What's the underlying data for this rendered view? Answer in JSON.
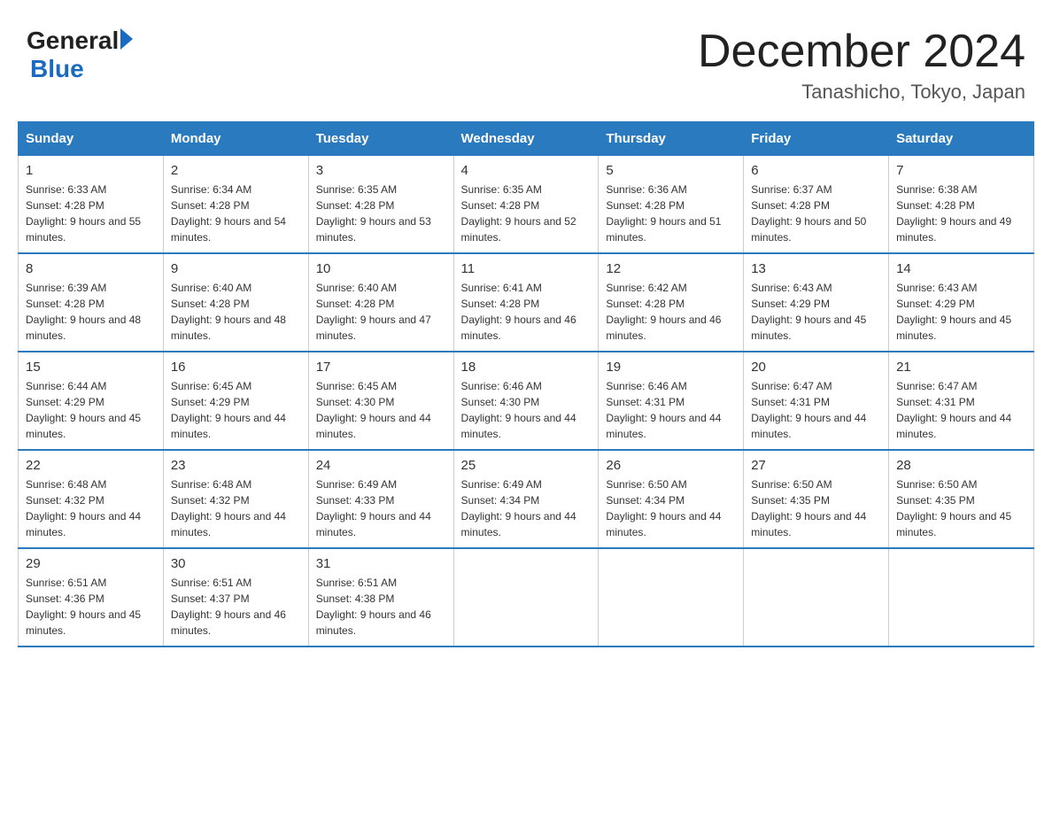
{
  "header": {
    "logo_general": "General",
    "logo_blue": "Blue",
    "month_title": "December 2024",
    "location": "Tanashicho, Tokyo, Japan"
  },
  "days_of_week": [
    "Sunday",
    "Monday",
    "Tuesday",
    "Wednesday",
    "Thursday",
    "Friday",
    "Saturday"
  ],
  "weeks": [
    [
      {
        "day": "1",
        "sunrise": "6:33 AM",
        "sunset": "4:28 PM",
        "daylight": "9 hours and 55 minutes."
      },
      {
        "day": "2",
        "sunrise": "6:34 AM",
        "sunset": "4:28 PM",
        "daylight": "9 hours and 54 minutes."
      },
      {
        "day": "3",
        "sunrise": "6:35 AM",
        "sunset": "4:28 PM",
        "daylight": "9 hours and 53 minutes."
      },
      {
        "day": "4",
        "sunrise": "6:35 AM",
        "sunset": "4:28 PM",
        "daylight": "9 hours and 52 minutes."
      },
      {
        "day": "5",
        "sunrise": "6:36 AM",
        "sunset": "4:28 PM",
        "daylight": "9 hours and 51 minutes."
      },
      {
        "day": "6",
        "sunrise": "6:37 AM",
        "sunset": "4:28 PM",
        "daylight": "9 hours and 50 minutes."
      },
      {
        "day": "7",
        "sunrise": "6:38 AM",
        "sunset": "4:28 PM",
        "daylight": "9 hours and 49 minutes."
      }
    ],
    [
      {
        "day": "8",
        "sunrise": "6:39 AM",
        "sunset": "4:28 PM",
        "daylight": "9 hours and 48 minutes."
      },
      {
        "day": "9",
        "sunrise": "6:40 AM",
        "sunset": "4:28 PM",
        "daylight": "9 hours and 48 minutes."
      },
      {
        "day": "10",
        "sunrise": "6:40 AM",
        "sunset": "4:28 PM",
        "daylight": "9 hours and 47 minutes."
      },
      {
        "day": "11",
        "sunrise": "6:41 AM",
        "sunset": "4:28 PM",
        "daylight": "9 hours and 46 minutes."
      },
      {
        "day": "12",
        "sunrise": "6:42 AM",
        "sunset": "4:28 PM",
        "daylight": "9 hours and 46 minutes."
      },
      {
        "day": "13",
        "sunrise": "6:43 AM",
        "sunset": "4:29 PM",
        "daylight": "9 hours and 45 minutes."
      },
      {
        "day": "14",
        "sunrise": "6:43 AM",
        "sunset": "4:29 PM",
        "daylight": "9 hours and 45 minutes."
      }
    ],
    [
      {
        "day": "15",
        "sunrise": "6:44 AM",
        "sunset": "4:29 PM",
        "daylight": "9 hours and 45 minutes."
      },
      {
        "day": "16",
        "sunrise": "6:45 AM",
        "sunset": "4:29 PM",
        "daylight": "9 hours and 44 minutes."
      },
      {
        "day": "17",
        "sunrise": "6:45 AM",
        "sunset": "4:30 PM",
        "daylight": "9 hours and 44 minutes."
      },
      {
        "day": "18",
        "sunrise": "6:46 AM",
        "sunset": "4:30 PM",
        "daylight": "9 hours and 44 minutes."
      },
      {
        "day": "19",
        "sunrise": "6:46 AM",
        "sunset": "4:31 PM",
        "daylight": "9 hours and 44 minutes."
      },
      {
        "day": "20",
        "sunrise": "6:47 AM",
        "sunset": "4:31 PM",
        "daylight": "9 hours and 44 minutes."
      },
      {
        "day": "21",
        "sunrise": "6:47 AM",
        "sunset": "4:31 PM",
        "daylight": "9 hours and 44 minutes."
      }
    ],
    [
      {
        "day": "22",
        "sunrise": "6:48 AM",
        "sunset": "4:32 PM",
        "daylight": "9 hours and 44 minutes."
      },
      {
        "day": "23",
        "sunrise": "6:48 AM",
        "sunset": "4:32 PM",
        "daylight": "9 hours and 44 minutes."
      },
      {
        "day": "24",
        "sunrise": "6:49 AM",
        "sunset": "4:33 PM",
        "daylight": "9 hours and 44 minutes."
      },
      {
        "day": "25",
        "sunrise": "6:49 AM",
        "sunset": "4:34 PM",
        "daylight": "9 hours and 44 minutes."
      },
      {
        "day": "26",
        "sunrise": "6:50 AM",
        "sunset": "4:34 PM",
        "daylight": "9 hours and 44 minutes."
      },
      {
        "day": "27",
        "sunrise": "6:50 AM",
        "sunset": "4:35 PM",
        "daylight": "9 hours and 44 minutes."
      },
      {
        "day": "28",
        "sunrise": "6:50 AM",
        "sunset": "4:35 PM",
        "daylight": "9 hours and 45 minutes."
      }
    ],
    [
      {
        "day": "29",
        "sunrise": "6:51 AM",
        "sunset": "4:36 PM",
        "daylight": "9 hours and 45 minutes."
      },
      {
        "day": "30",
        "sunrise": "6:51 AM",
        "sunset": "4:37 PM",
        "daylight": "9 hours and 46 minutes."
      },
      {
        "day": "31",
        "sunrise": "6:51 AM",
        "sunset": "4:38 PM",
        "daylight": "9 hours and 46 minutes."
      },
      null,
      null,
      null,
      null
    ]
  ]
}
